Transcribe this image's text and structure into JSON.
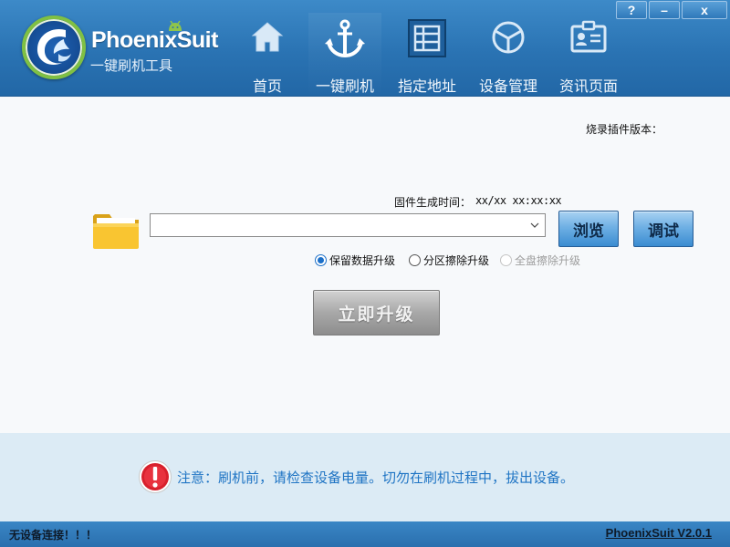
{
  "app": {
    "name": "PhoenixSuit",
    "subtitle": "一键刷机工具"
  },
  "window_buttons": {
    "help": "?",
    "minimize": "–",
    "close": "x"
  },
  "nav": {
    "items": [
      {
        "label": "首页",
        "icon": "home-icon",
        "active": false
      },
      {
        "label": "一键刷机",
        "icon": "anchor-icon",
        "active": true
      },
      {
        "label": "指定地址",
        "icon": "grid-address-icon",
        "active": false
      },
      {
        "label": "设备管理",
        "icon": "device-cube-icon",
        "active": false
      },
      {
        "label": "资讯页面",
        "icon": "id-card-icon",
        "active": false
      }
    ]
  },
  "main": {
    "plugin_version_label": "烧录插件版本：",
    "firmware_time_label": "固件生成时间：",
    "firmware_time_value": "xx/xx xx:xx:xx",
    "file_path_value": "",
    "browse_label": "浏览",
    "debug_label": "调试",
    "radios": [
      {
        "label": "保留数据升级",
        "selected": true,
        "disabled": false
      },
      {
        "label": "分区擦除升级",
        "selected": false,
        "disabled": false
      },
      {
        "label": "全盘擦除升级",
        "selected": false,
        "disabled": true
      }
    ],
    "upgrade_label": "立即升级"
  },
  "notice": {
    "text": "注意：刷机前，请检查设备电量。切勿在刷机过程中，拔出设备。"
  },
  "status": {
    "connection": "无设备连接！！！",
    "version": "PhoenixSuit V2.0.1"
  },
  "colors": {
    "header_blue": "#2a73b3",
    "accent_green": "#7fc043",
    "notice_text": "#1f74c4",
    "warning_red": "#d8202c"
  }
}
